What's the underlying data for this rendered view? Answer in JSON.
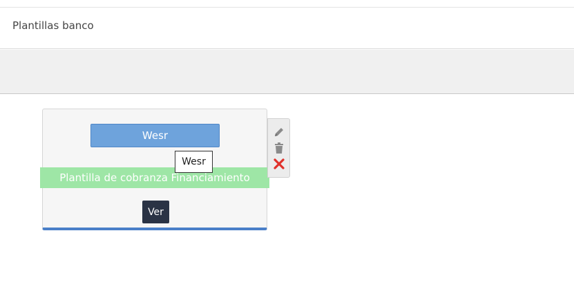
{
  "header": {
    "title": "Plantillas banco"
  },
  "card": {
    "primary_button_label": "Wesr",
    "template_name": "Plantilla de cobranza Financiamiento",
    "view_button_label": "Ver",
    "tooltip_text": "Wesr"
  },
  "actions": {
    "icons": [
      "pencil-icon",
      "trash-icon",
      "close-icon"
    ]
  },
  "colors": {
    "primary": "#6ea3dc",
    "success_label": "#9ee6a6",
    "dark_button": "#2a3345",
    "card_accent": "#4a7fc8",
    "delete_red": "#e0312b"
  }
}
